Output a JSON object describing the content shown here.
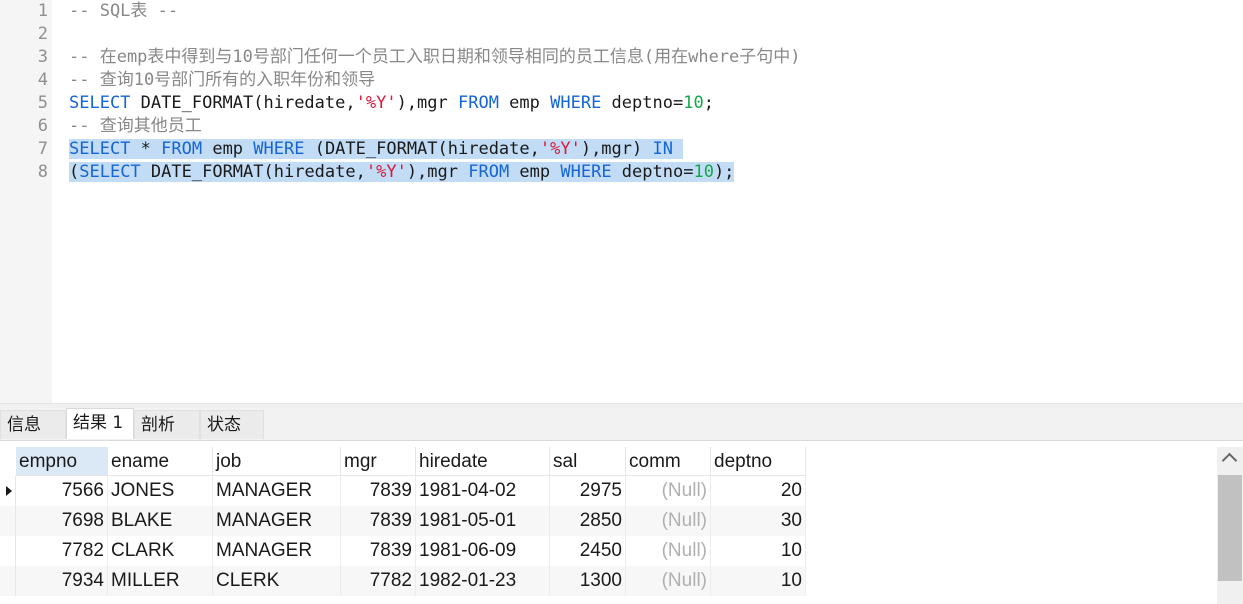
{
  "editor": {
    "line_numbers": [
      "1",
      "2",
      "3",
      "4",
      "5",
      "6",
      "7",
      "8"
    ],
    "comment1": "-- SQL表 --",
    "comment3": "-- 在emp表中得到与10号部门任何一个员工入职日期和领导相同的员工信息(用在where子句中)",
    "comment4": "-- 查询10号部门所有的入职年份和领导",
    "comment6": "-- 查询其他员工",
    "kw_select": "SELECT",
    "kw_from": "FROM",
    "kw_where": "WHERE",
    "kw_in": "IN",
    "date_format_open": "DATE_FORMAT(hiredate,",
    "pct_y": "'%Y'",
    "mgr_from_tail": "),mgr ",
    "emp": " emp ",
    "deptno_eq": " deptno=",
    "ten": "10",
    "semicolon": ";",
    "star": " * ",
    "paren_date_format": " (DATE_FORMAT(hiredate,",
    "mgr_close": "),mgr) ",
    "open_paren": "(",
    "close_semicolon": ");"
  },
  "tabs": [
    "信息",
    "结果 1",
    "剖析",
    "状态"
  ],
  "results": {
    "columns": [
      "empno",
      "ename",
      "job",
      "mgr",
      "hiredate",
      "sal",
      "comm",
      "deptno"
    ],
    "rows": [
      [
        "7566",
        "JONES",
        "MANAGER",
        "7839",
        "1981-04-02",
        "2975",
        "(Null)",
        "20"
      ],
      [
        "7698",
        "BLAKE",
        "MANAGER",
        "7839",
        "1981-05-01",
        "2850",
        "(Null)",
        "30"
      ],
      [
        "7782",
        "CLARK",
        "MANAGER",
        "7839",
        "1981-06-09",
        "2450",
        "(Null)",
        "10"
      ],
      [
        "7934",
        "MILLER",
        "CLERK",
        "7782",
        "1982-01-23",
        "1300",
        "(Null)",
        "10"
      ]
    ]
  },
  "colors": {
    "keyword": "#1565d6",
    "string": "#d81a3c",
    "number": "#14a84a",
    "comment": "#888888",
    "selection": "#c2dcf5"
  }
}
